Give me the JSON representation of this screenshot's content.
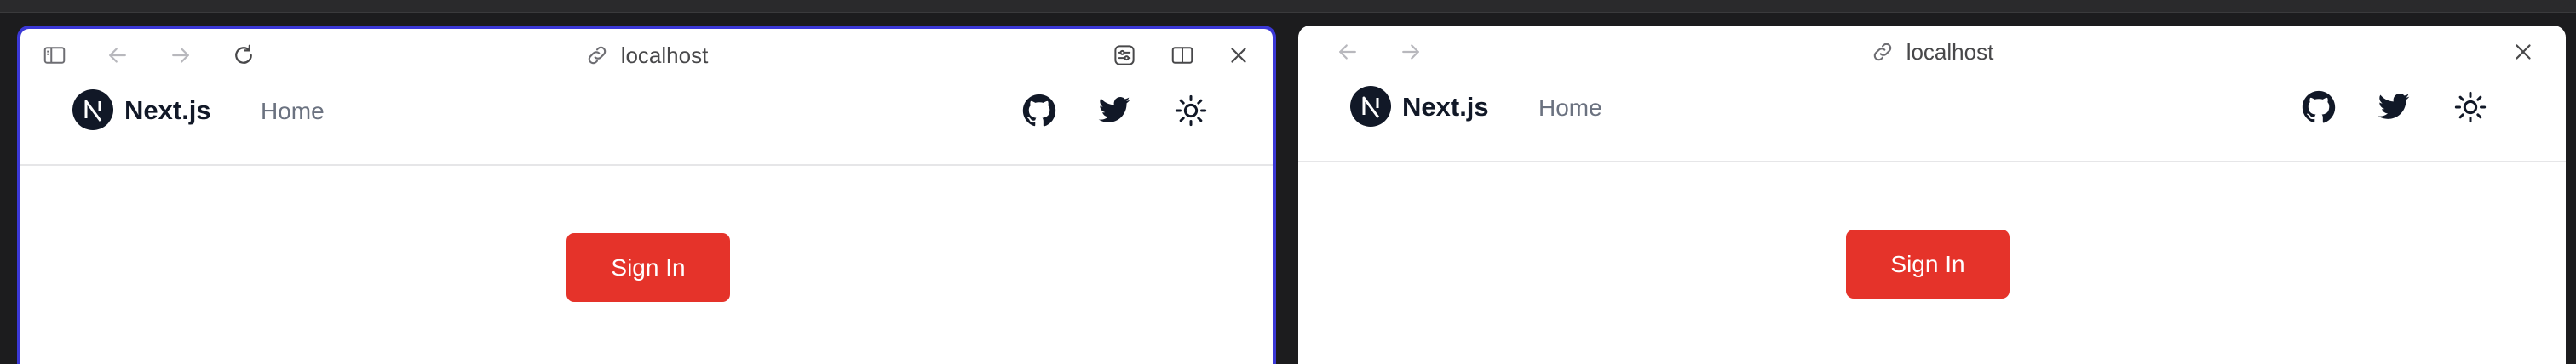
{
  "colors": {
    "accent": "#e5332a",
    "active_border": "#3b38d6",
    "text_dark": "#111827",
    "text_muted": "#6b7280"
  },
  "left_pane": {
    "url": "localhost",
    "toolbar_icons": [
      "sidebar-icon",
      "back-arrow-icon",
      "forward-arrow-icon",
      "reload-icon",
      "sliders-icon",
      "split-view-icon",
      "close-icon"
    ],
    "brand": "Next.js",
    "nav_link": "Home",
    "nav_icons": [
      "github-icon",
      "twitter-icon",
      "sun-icon"
    ],
    "button_label": "Sign In"
  },
  "right_pane": {
    "url": "localhost",
    "toolbar_icons": [
      "back-arrow-icon",
      "forward-arrow-icon",
      "close-icon"
    ],
    "brand": "Next.js",
    "nav_link": "Home",
    "nav_icons": [
      "github-icon",
      "twitter-icon",
      "sun-icon"
    ],
    "button_label": "Sign In"
  }
}
